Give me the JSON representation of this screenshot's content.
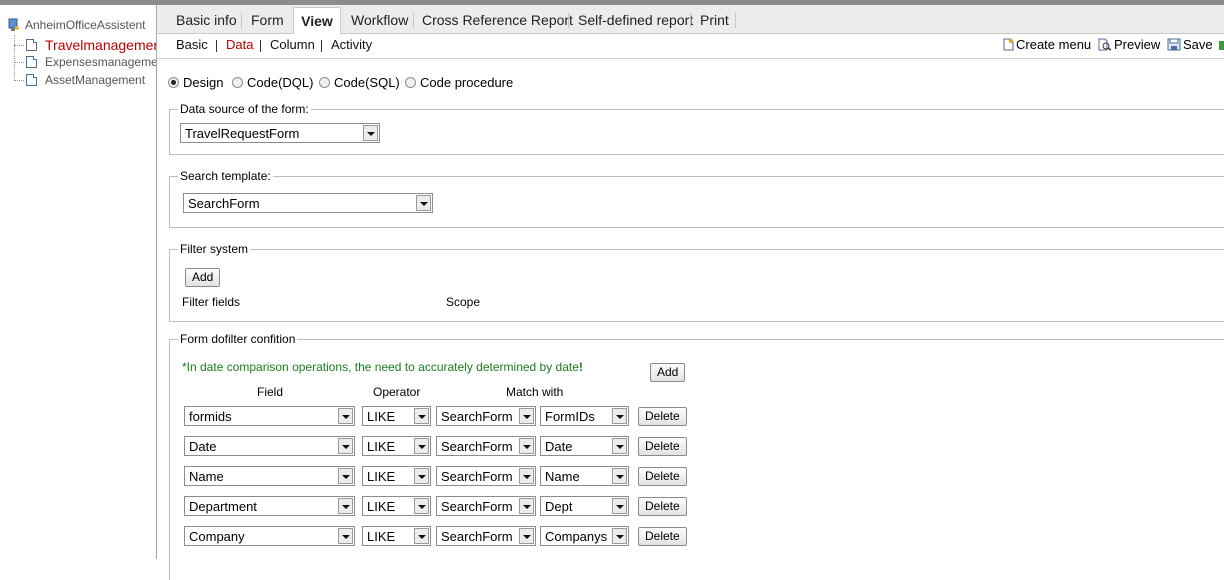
{
  "sidebar": {
    "root": "AnheimOfficeAssistent",
    "items": [
      {
        "label": "Travelmanagement"
      },
      {
        "label": "Expensesmanagement"
      },
      {
        "label": "AssetManagement"
      }
    ]
  },
  "tabs": [
    "Basic info",
    "Form",
    "View",
    "Workflow",
    "Cross Reference Report",
    "Self-defined report",
    "Print"
  ],
  "subtabs": [
    "Basic",
    "Data",
    "Column",
    "Activity"
  ],
  "toolbar": {
    "create_menu": "Create menu",
    "preview": "Preview",
    "save": "Save"
  },
  "mode_options": [
    "Design",
    "Code(DQL)",
    "Code(SQL)",
    "Code procedure"
  ],
  "datasource": {
    "legend": "Data source of the form:",
    "value": "TravelRequestForm"
  },
  "search_template": {
    "legend": "Search template:",
    "value": "SearchForm"
  },
  "filter_system": {
    "legend": "Filter system",
    "add": "Add",
    "col_fields": "Filter fields",
    "col_scope": "Scope"
  },
  "dofilter": {
    "legend": "Form dofilter confition",
    "hint": "*In date comparison operations, the need to accurately determined by date",
    "hint_mark": "!",
    "add": "Add",
    "headers": {
      "field": "Field",
      "operator": "Operator",
      "match": "Match with"
    },
    "rows": [
      {
        "field": "formids",
        "operator": "LIKE",
        "source": "SearchForm",
        "target": "FormIDs",
        "delete": "Delete"
      },
      {
        "field": "Date",
        "operator": "LIKE",
        "source": "SearchForm",
        "target": "Date",
        "delete": "Delete"
      },
      {
        "field": "Name",
        "operator": "LIKE",
        "source": "SearchForm",
        "target": "Name",
        "delete": "Delete"
      },
      {
        "field": "Department",
        "operator": "LIKE",
        "source": "SearchForm",
        "target": "Dept",
        "delete": "Delete"
      },
      {
        "field": "Company",
        "operator": "LIKE",
        "source": "SearchForm",
        "target": "Companys",
        "delete": "Delete"
      }
    ]
  }
}
